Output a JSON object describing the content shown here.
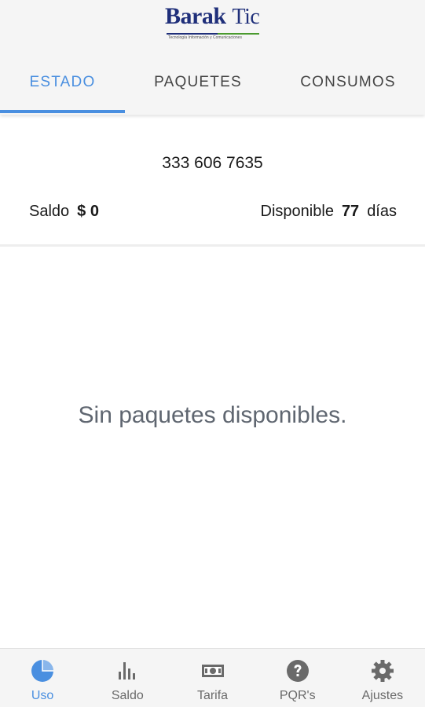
{
  "header": {
    "logo": {
      "word": "Barak",
      "word2": "Tic",
      "tagline": "Tecnología Información y Comunicaciones"
    },
    "tabs": [
      {
        "label": "ESTADO",
        "active": true
      },
      {
        "label": "PAQUETES",
        "active": false
      },
      {
        "label": "CONSUMOS",
        "active": false
      }
    ]
  },
  "account": {
    "phone": "333 606 7635",
    "saldo_label": "Saldo",
    "saldo_value": "$ 0",
    "disponible_label": "Disponible",
    "disponible_value": "77",
    "disponible_unit": "días"
  },
  "main": {
    "empty_message": "Sin paquetes disponibles."
  },
  "bottom_nav": {
    "items": [
      {
        "label": "Uso",
        "icon": "pie-chart-icon",
        "active": true
      },
      {
        "label": "Saldo",
        "icon": "bar-chart-icon",
        "active": false
      },
      {
        "label": "Tarifa",
        "icon": "money-icon",
        "active": false
      },
      {
        "label": "PQR's",
        "icon": "help-circle-icon",
        "active": false
      },
      {
        "label": "Ajustes",
        "icon": "gear-icon",
        "active": false
      }
    ]
  },
  "colors": {
    "accent": "#4a8fe0",
    "text": "#1a1a1a",
    "muted": "#6a6a6a",
    "logo_blue": "#1f2f7a",
    "logo_green": "#4a9a2e"
  }
}
